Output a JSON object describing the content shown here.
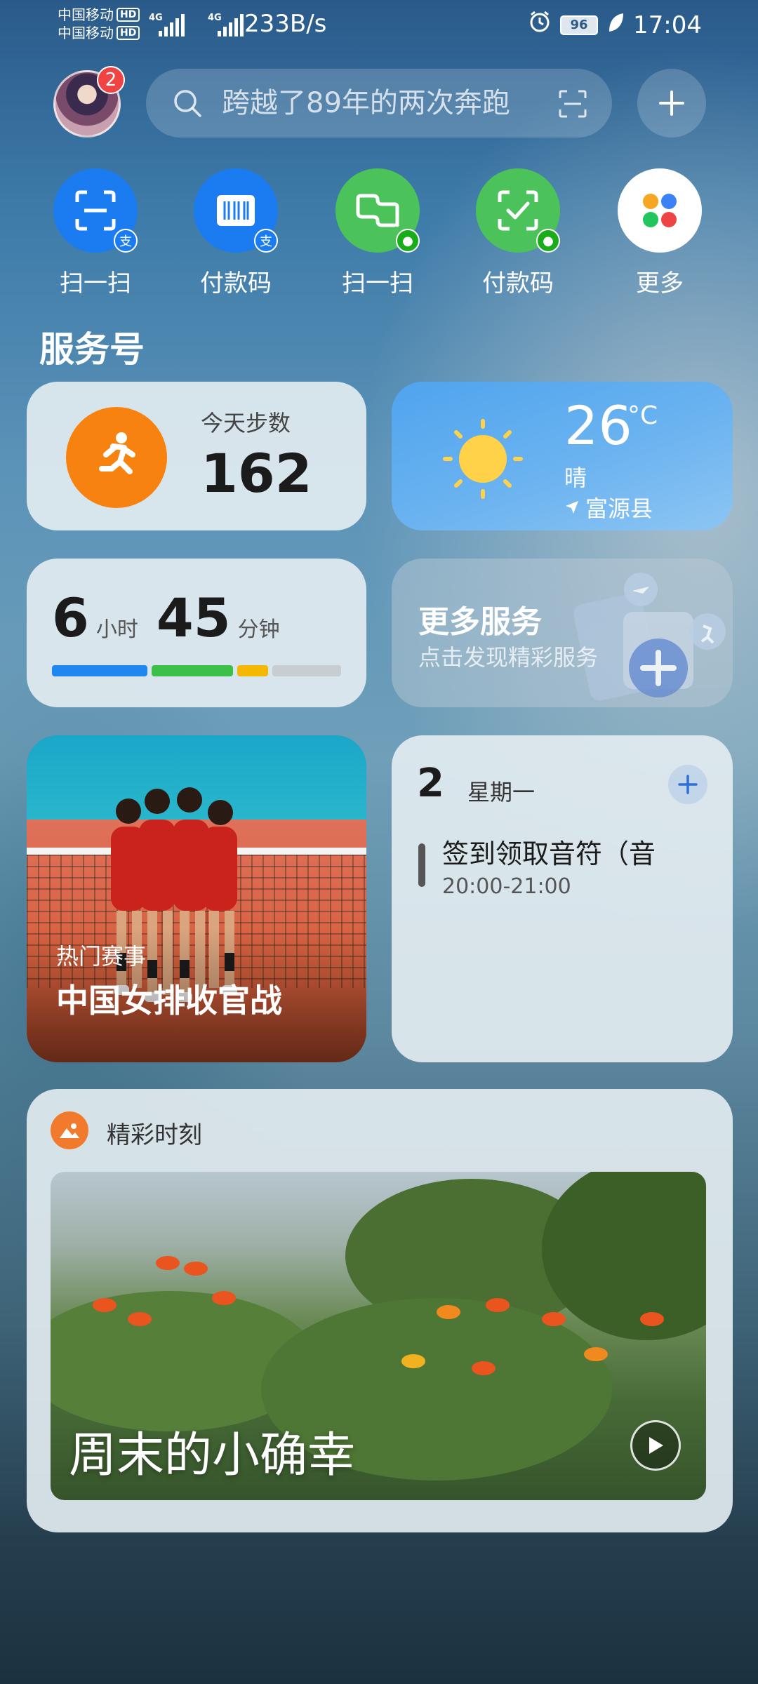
{
  "status_bar": {
    "carrier1": "中国移动",
    "carrier2": "中国移动",
    "hd": "HD",
    "net1": "4G",
    "net2": "4G",
    "speed": "233B/s",
    "battery": "96",
    "time": "17:04"
  },
  "top": {
    "avatar_badge": "2",
    "search_placeholder": "跨越了89年的两次奔跑"
  },
  "quick_actions": [
    {
      "label": "扫一扫",
      "icon": "alipay-scan-icon",
      "color": "#1a7cf0"
    },
    {
      "label": "付款码",
      "icon": "alipay-paycode-icon",
      "color": "#1a7cf0"
    },
    {
      "label": "扫一扫",
      "icon": "wechat-scan-icon",
      "color": "#4cc25a"
    },
    {
      "label": "付款码",
      "icon": "wechat-paycode-icon",
      "color": "#4cc25a"
    },
    {
      "label": "更多",
      "icon": "more-apps-icon",
      "color": "#ffffff"
    }
  ],
  "section_title": "服务号",
  "steps": {
    "title": "今天步数",
    "value": "162"
  },
  "weather": {
    "temp": "26",
    "unit": "°C",
    "condition": "晴",
    "location": "富源县"
  },
  "sleep": {
    "hours": "6",
    "hours_unit": "小时",
    "minutes": "45",
    "minutes_unit": "分钟"
  },
  "more_services": {
    "title": "更多服务",
    "subtitle": "点击发现精彩服务"
  },
  "sports": {
    "tag": "热门赛事",
    "title": "中国女排收官战"
  },
  "calendar": {
    "day": "2",
    "weekday": "星期一",
    "event": "签到领取音符（音",
    "time": "20:00-21:00"
  },
  "moments": {
    "title": "精彩时刻",
    "caption": "周末的小确幸"
  },
  "colors": {
    "accent_orange": "#f7820f",
    "alipay_blue": "#1a7cf0",
    "wechat_green": "#4cc25a"
  }
}
